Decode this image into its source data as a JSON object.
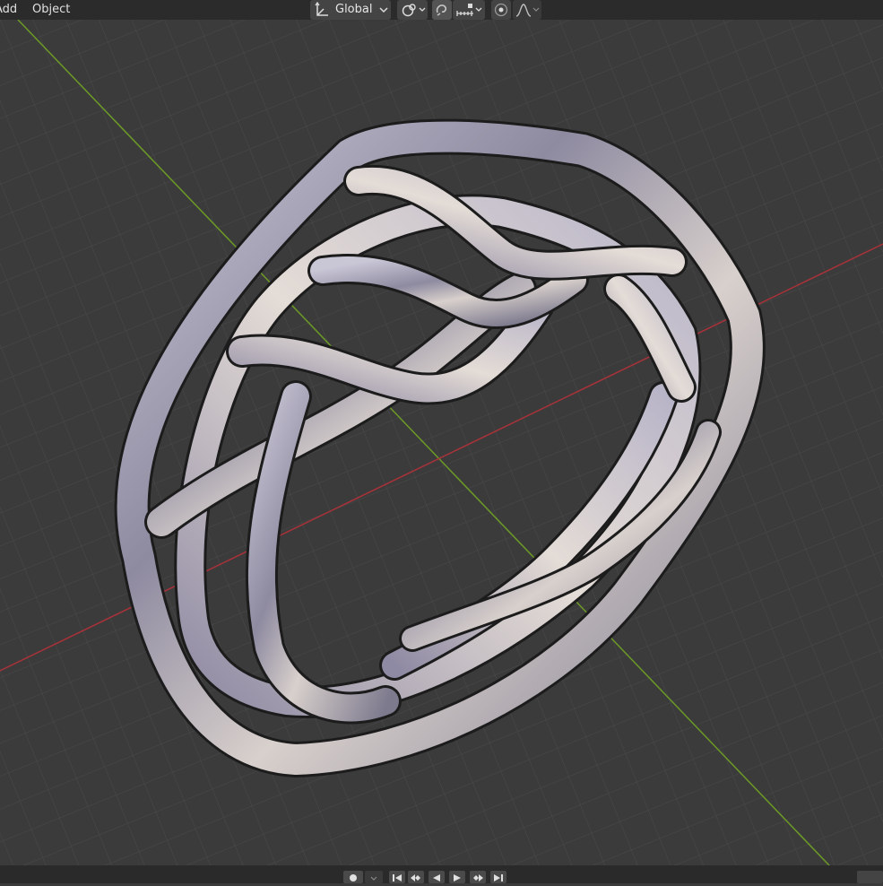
{
  "header": {
    "menu_add": "Add",
    "menu_object": "Object",
    "orientation": {
      "label": "Global",
      "icon": "transform-orientation-icon",
      "dropdown_icon": "chevron-down-icon"
    },
    "pivot_icon": "pivot-point-icon",
    "snap_toggle_icon": "snap-magnet-icon",
    "snap_target_icon": "snap-increment-icon",
    "proportional_edit_icon": "proportional-editing-icon",
    "falloff_icon": "falloff-curve-icon"
  },
  "viewport": {
    "object": "braided-ring-mesh",
    "x_axis_color": "#a8323a",
    "y_axis_color": "#6c9a26",
    "grid_color": "#4c4c4c",
    "background": "#3b3b3b",
    "metal_color": "#a8a3b4"
  },
  "footer": {
    "record_icon": "record-icon",
    "playback_icons": [
      "jump-to-start-icon",
      "jump-to-keyframe-prev-icon",
      "play-reverse-icon",
      "play-icon",
      "jump-to-keyframe-next-icon",
      "jump-to-end-icon"
    ]
  }
}
